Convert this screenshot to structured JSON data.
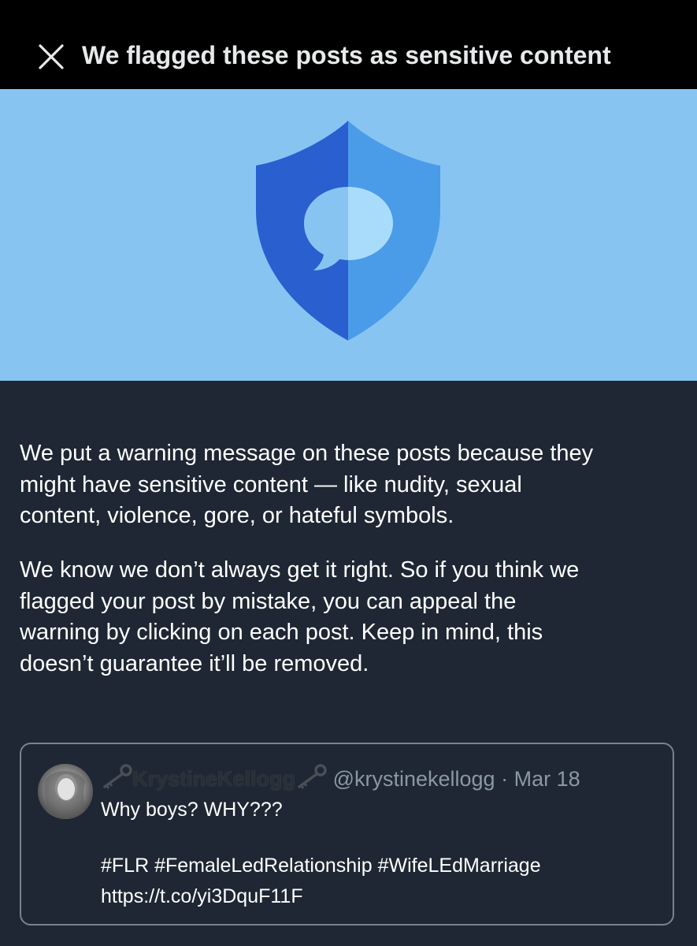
{
  "header": {
    "title": "We flagged these posts as sensitive content",
    "close_icon": "close-icon"
  },
  "hero": {
    "icon": "shield-chat-icon",
    "colors": {
      "background": "#87c4f2",
      "shield_dark": "#2a5fcf",
      "shield_light": "#4b9ce8",
      "bubble_left": "#87c4f2",
      "bubble_right": "#a9dcfb"
    }
  },
  "body": {
    "paragraph1_lines": [
      "We put a warning message on these posts because they",
      "might have sensitive content — like nudity, sexual",
      "content, violence, gore, or hateful symbols."
    ],
    "paragraph2_lines": [
      "We know we don’t always get it right. So if you think we",
      "flagged your post by mistake, you can appeal the",
      "warning by clicking on each post. Keep in mind, this",
      "doesn’t guarantee it’ll be removed."
    ]
  },
  "post": {
    "display_name": "KrystineKellogg",
    "name_emoji": "key-icon",
    "handle": "@krystinekellogg",
    "separator": "·",
    "date": "Mar 18",
    "text_line1": "Why boys? WHY???",
    "hashtags": "#FLR #FemaleLedRelationship #WifeLEdMarriage",
    "link": "https://t.co/yi3DquF11F"
  }
}
